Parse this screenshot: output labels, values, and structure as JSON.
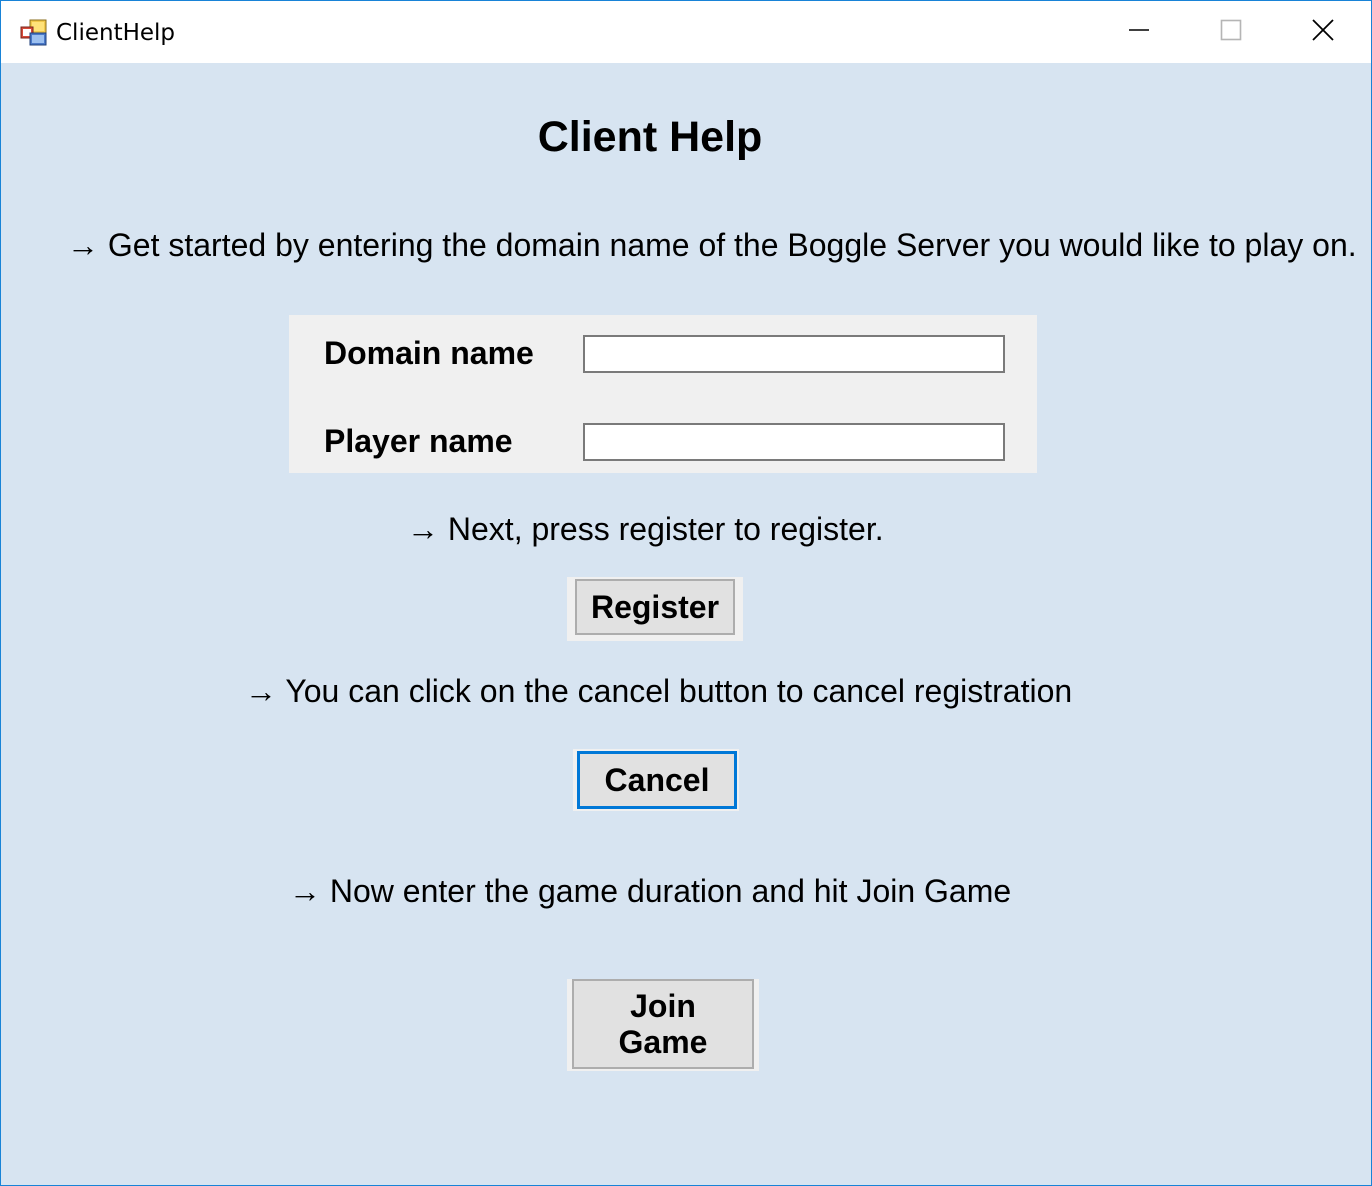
{
  "window": {
    "title": "ClientHelp",
    "icon": "winforms-app-icon",
    "controls": {
      "minimize_icon": "minimize-icon",
      "maximize_icon": "maximize-icon",
      "close_icon": "close-icon"
    }
  },
  "content": {
    "heading": "Client Help",
    "instruction_1": "→ Get started by entering the domain name of the Boggle Server you would like to play on.",
    "domain_label": "Domain name",
    "domain_value": "",
    "player_label": "Player name",
    "player_value": "",
    "instruction_2": "→ Next, press register to register.",
    "register_label": "Register",
    "instruction_3": "→ You can click on the cancel button to cancel registration",
    "cancel_label": "Cancel",
    "instruction_4": "→ Now enter the game duration and hit Join Game",
    "join_label": "Join Game"
  },
  "colors": {
    "client_background": "#d7e4f1",
    "panel_background": "#f0f0f0",
    "button_face": "#e1e1e1",
    "focus_border": "#0078d7",
    "window_border": "#1883d7"
  }
}
